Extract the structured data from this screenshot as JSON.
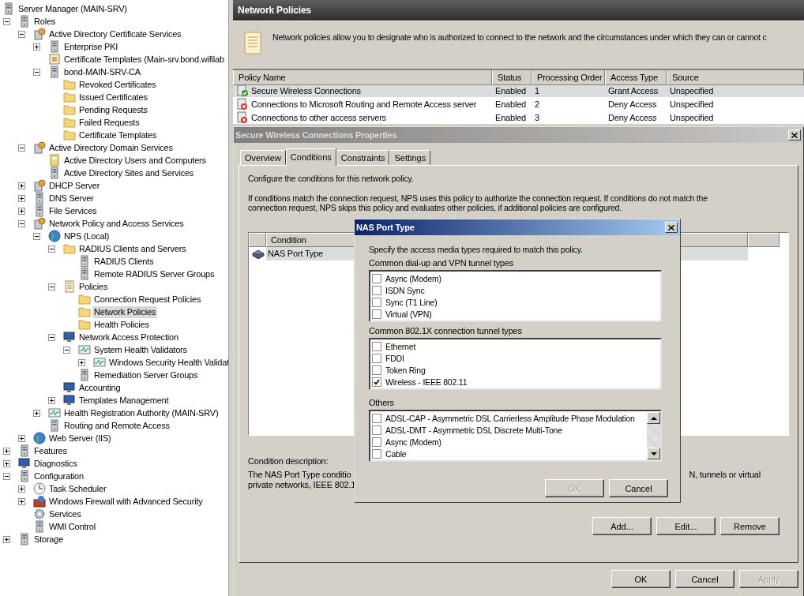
{
  "tree": {
    "title": "Server Manager (MAIN-SRV)",
    "kind": "server",
    "selected": false,
    "children": [
      {
        "label": "Roles",
        "kind": "server",
        "expanded": true,
        "selected": false,
        "children": [
          {
            "label": "Active Directory Certificate Services",
            "kind": "role",
            "expanded": true,
            "selected": false,
            "children": [
              {
                "label": "Enterprise PKI",
                "kind": "server",
                "expanded": false,
                "selected": false
              },
              {
                "label": "Certificate Templates (Main-srv.bond.wifilab",
                "kind": "cert",
                "selected": false
              },
              {
                "label": "bond-MAIN-SRV-CA",
                "kind": "server",
                "expanded": true,
                "selected": false,
                "children": [
                  {
                    "label": "Revoked Certificates",
                    "kind": "folder",
                    "selected": false
                  },
                  {
                    "label": "Issued Certificates",
                    "kind": "folder",
                    "selected": false
                  },
                  {
                    "label": "Pending Requests",
                    "kind": "folder",
                    "selected": false
                  },
                  {
                    "label": "Failed Requests",
                    "kind": "folder",
                    "selected": false
                  },
                  {
                    "label": "Certificate Templates",
                    "kind": "folder",
                    "selected": false
                  }
                ]
              }
            ]
          },
          {
            "label": "Active Directory Domain Services",
            "kind": "role",
            "expanded": true,
            "selected": false,
            "children": [
              {
                "label": "Active Directory Users and Computers",
                "kind": "book",
                "selected": false
              },
              {
                "label": "Active Directory Sites and Services",
                "kind": "server",
                "selected": false
              }
            ]
          },
          {
            "label": "DHCP Server",
            "kind": "role",
            "expanded": false,
            "selected": false
          },
          {
            "label": "DNS Server",
            "kind": "server",
            "expanded": false,
            "selected": false
          },
          {
            "label": "File Services",
            "kind": "server",
            "expanded": false,
            "selected": false
          },
          {
            "label": "Network Policy and Access Services",
            "kind": "role",
            "expanded": true,
            "selected": false,
            "children": [
              {
                "label": "NPS (Local)",
                "kind": "globe",
                "expanded": true,
                "selected": false,
                "children": [
                  {
                    "label": "RADIUS Clients and Servers",
                    "kind": "folder",
                    "expanded": true,
                    "selected": false,
                    "children": [
                      {
                        "label": "RADIUS Clients",
                        "kind": "server",
                        "selected": false
                      },
                      {
                        "label": "Remote RADIUS Server Groups",
                        "kind": "server",
                        "selected": false
                      }
                    ]
                  },
                  {
                    "label": "Policies",
                    "kind": "scroll",
                    "expanded": true,
                    "selected": false,
                    "children": [
                      {
                        "label": "Connection Request Policies",
                        "kind": "folder",
                        "selected": false
                      },
                      {
                        "label": "Network Policies",
                        "kind": "folder",
                        "selected": true
                      },
                      {
                        "label": "Health Policies",
                        "kind": "folder",
                        "selected": false
                      }
                    ]
                  },
                  {
                    "label": "Network Access Protection",
                    "kind": "monitor",
                    "expanded": true,
                    "selected": false,
                    "children": [
                      {
                        "label": "System Health Validators",
                        "kind": "pulse",
                        "expanded": true,
                        "selected": false,
                        "children": [
                          {
                            "label": "Windows Security Health Validat",
                            "kind": "pulse",
                            "expanded": false,
                            "selected": false
                          }
                        ]
                      },
                      {
                        "label": "Remediation Server Groups",
                        "kind": "server",
                        "selected": false
                      }
                    ]
                  },
                  {
                    "label": "Accounting",
                    "kind": "monitor",
                    "selected": false
                  },
                  {
                    "label": "Templates Management",
                    "kind": "monitor",
                    "expanded": false,
                    "selected": false
                  }
                ]
              },
              {
                "label": "Health Registration Authority (MAIN-SRV)",
                "kind": "pulse",
                "expanded": false,
                "selected": false
              },
              {
                "label": "Routing and Remote Access",
                "kind": "server",
                "selected": false
              }
            ]
          },
          {
            "label": "Web Server (IIS)",
            "kind": "globe",
            "expanded": false,
            "selected": false
          }
        ]
      },
      {
        "label": "Features",
        "kind": "server",
        "expanded": false,
        "selected": false
      },
      {
        "label": "Diagnostics",
        "kind": "monitor",
        "expanded": false,
        "selected": false
      },
      {
        "label": "Configuration",
        "kind": "server",
        "expanded": true,
        "selected": false,
        "children": [
          {
            "label": "Task Scheduler",
            "kind": "clock",
            "expanded": false,
            "selected": false
          },
          {
            "label": "Windows Firewall with Advanced Security",
            "kind": "wall",
            "expanded": false,
            "selected": false
          },
          {
            "label": "Services",
            "kind": "gear",
            "selected": false
          },
          {
            "label": "WMI Control",
            "kind": "server",
            "selected": false
          }
        ]
      },
      {
        "label": "Storage",
        "kind": "server",
        "expanded": false,
        "selected": false
      }
    ]
  },
  "panel": {
    "title": "Network Policies",
    "description": "Network policies allow you to designate who is authorized to connect to the network and the circumstances under which they can or cannot c",
    "columns": [
      "Policy Name",
      "Status",
      "Processing Order",
      "Access Type",
      "Source"
    ],
    "rows": [
      {
        "kind": "grant",
        "selected": true,
        "cells": [
          "Secure Wireless Connections",
          "Enabled",
          "1",
          "Grant Access",
          "Unspecified"
        ]
      },
      {
        "kind": "deny",
        "selected": false,
        "cells": [
          "Connections to Microsoft Routing and Remote Access server",
          "Enabled",
          "2",
          "Deny Access",
          "Unspecified"
        ]
      },
      {
        "kind": "deny",
        "selected": false,
        "cells": [
          "Connections to other access servers",
          "Enabled",
          "3",
          "Deny Access",
          "Unspecified"
        ]
      }
    ]
  },
  "properties": {
    "title": "Secure Wireless Connections Properties",
    "tabs": [
      {
        "label": "Overview",
        "selected": false
      },
      {
        "label": "Conditions",
        "selected": true
      },
      {
        "label": "Constraints",
        "selected": false
      },
      {
        "label": "Settings",
        "selected": false
      }
    ],
    "intro": "Configure the conditions for this network policy.",
    "details": "If conditions match the connection request, NPS uses this policy to authorize the connection request. If conditions do not match the connection request, NPS skips this policy and evaluates other policies, if additional policies are configured.",
    "conditions": {
      "columns": [
        "Condition"
      ],
      "rows": [
        {
          "name": "NAS Port Type",
          "selected": true
        }
      ]
    },
    "description_label": "Condition description:",
    "description_left": [
      "The NAS Port Type conditio",
      "private networks, IEEE 802.1"
    ],
    "description_right": "N, tunnels or virtual",
    "list_buttons": [
      {
        "label": "Add...",
        "disabled": false
      },
      {
        "label": "Edit...",
        "disabled": false
      },
      {
        "label": "Remove",
        "disabled": false
      }
    ],
    "buttons": [
      {
        "label": "OK",
        "disabled": false
      },
      {
        "label": "Cancel",
        "disabled": false
      },
      {
        "label": "Apply",
        "disabled": true
      }
    ]
  },
  "nas_dialog": {
    "title": "NAS Port Type",
    "instruction": "Specify the access media types required to match this policy.",
    "groups": [
      {
        "label": "Common dial-up and VPN tunnel types",
        "kind": "plain",
        "items": [
          {
            "label": "Async (Modem)",
            "checked": false
          },
          {
            "label": "ISDN Sync",
            "checked": false
          },
          {
            "label": "Sync (T1 Line)",
            "checked": false
          },
          {
            "label": "Virtual (VPN)",
            "checked": false
          }
        ]
      },
      {
        "label": "Common 802.1X connection tunnel types",
        "kind": "plain",
        "items": [
          {
            "label": "Ethernet",
            "checked": false
          },
          {
            "label": "FDDI",
            "checked": false
          },
          {
            "label": "Token Ring",
            "checked": false
          },
          {
            "label": "Wireless - IEEE 802.11",
            "checked": true
          }
        ]
      },
      {
        "label": "Others",
        "kind": "scrolling",
        "items": [
          {
            "label": "ADSL-CAP - Asymmetric DSL Carrierless Amplitude Phase Modulation",
            "checked": false
          },
          {
            "label": "ADSL-DMT - Asymmetric DSL Discrete Multi-Tone",
            "checked": false
          },
          {
            "label": "Async (Modem)",
            "checked": false
          },
          {
            "label": "Cable",
            "checked": false
          }
        ]
      }
    ],
    "buttons": [
      {
        "label": "OK",
        "disabled": true
      },
      {
        "label": "Cancel",
        "disabled": false
      }
    ]
  }
}
